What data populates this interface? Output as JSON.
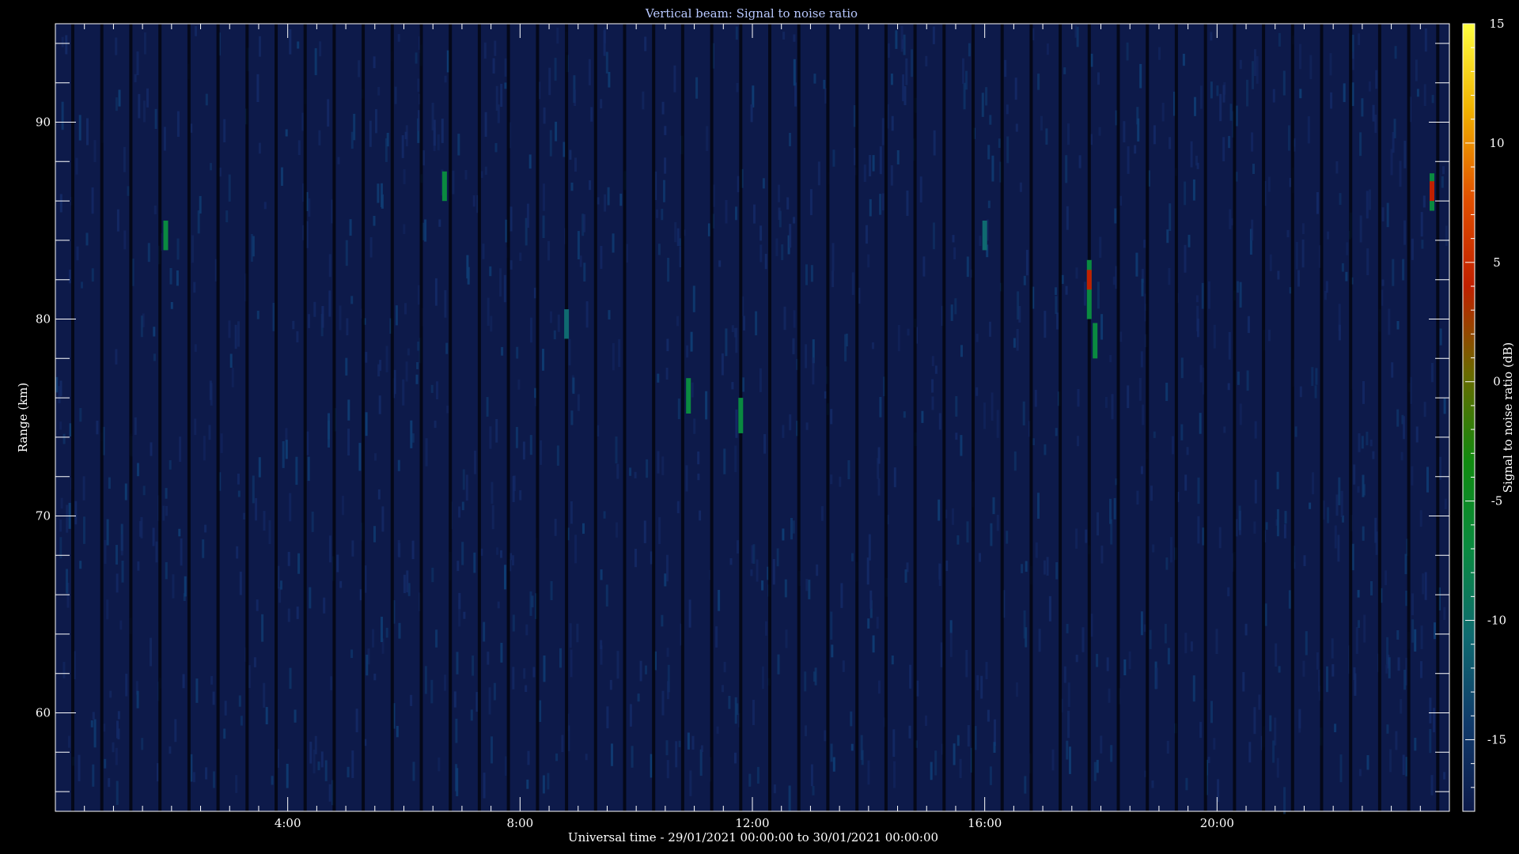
{
  "chart_data": {
    "type": "heatmap",
    "title": "Vertical beam: Signal to noise ratio",
    "xlabel": "Universal time - 29/01/2021 00:00:00 to 30/01/2021 00:00:00",
    "ylabel": "Range (km)",
    "xlim": [
      0,
      24
    ],
    "ylim": [
      55,
      95
    ],
    "x_ticks": [
      {
        "value": 4,
        "label": "4:00"
      },
      {
        "value": 8,
        "label": "8:00"
      },
      {
        "value": 12,
        "label": "12:00"
      },
      {
        "value": 16,
        "label": "16:00"
      },
      {
        "value": 20,
        "label": "20:00"
      }
    ],
    "y_ticks": [
      {
        "value": 60,
        "label": "60"
      },
      {
        "value": 70,
        "label": "70"
      },
      {
        "value": 80,
        "label": "80"
      },
      {
        "value": 90,
        "label": "90"
      }
    ],
    "colorbar": {
      "label": "Signal to noise ratio (dB)",
      "range": [
        -18,
        15
      ],
      "ticks": [
        {
          "value": 15,
          "label": "15"
        },
        {
          "value": 10,
          "label": "10"
        },
        {
          "value": 5,
          "label": "5"
        },
        {
          "value": 0,
          "label": "0"
        },
        {
          "value": -5,
          "label": "-5"
        },
        {
          "value": -10,
          "label": "-10"
        },
        {
          "value": -15,
          "label": "-15"
        }
      ],
      "colors": [
        "#0d1a4a",
        "#103a6a",
        "#0f6a70",
        "#0a8a40",
        "#108a10",
        "#6a6a00",
        "#c02000",
        "#e05000",
        "#f0b000",
        "#ffff40"
      ]
    },
    "background_snr_db": -16,
    "echoes": [
      {
        "time": 1.9,
        "range_from": 83.5,
        "range_to": 85.0,
        "snr_db": -7
      },
      {
        "time": 6.7,
        "range_from": 86.0,
        "range_to": 87.5,
        "snr_db": -6
      },
      {
        "time": 8.8,
        "range_from": 79.0,
        "range_to": 80.5,
        "snr_db": -11
      },
      {
        "time": 10.9,
        "range_from": 75.2,
        "range_to": 77.0,
        "snr_db": -7
      },
      {
        "time": 11.8,
        "range_from": 74.2,
        "range_to": 76.0,
        "snr_db": -6
      },
      {
        "time": 16.0,
        "range_from": 83.5,
        "range_to": 85.0,
        "snr_db": -11
      },
      {
        "time": 17.8,
        "range_from": 80.0,
        "range_to": 83.0,
        "snr_db": -6
      },
      {
        "time": 17.8,
        "range_from": 81.5,
        "range_to": 82.5,
        "snr_db": 3
      },
      {
        "time": 17.9,
        "range_from": 78.0,
        "range_to": 79.8,
        "snr_db": -7
      },
      {
        "time": 23.7,
        "range_from": 85.5,
        "range_to": 87.4,
        "snr_db": -7
      },
      {
        "time": 23.7,
        "range_from": 86.0,
        "range_to": 87.0,
        "snr_db": 2
      }
    ]
  }
}
